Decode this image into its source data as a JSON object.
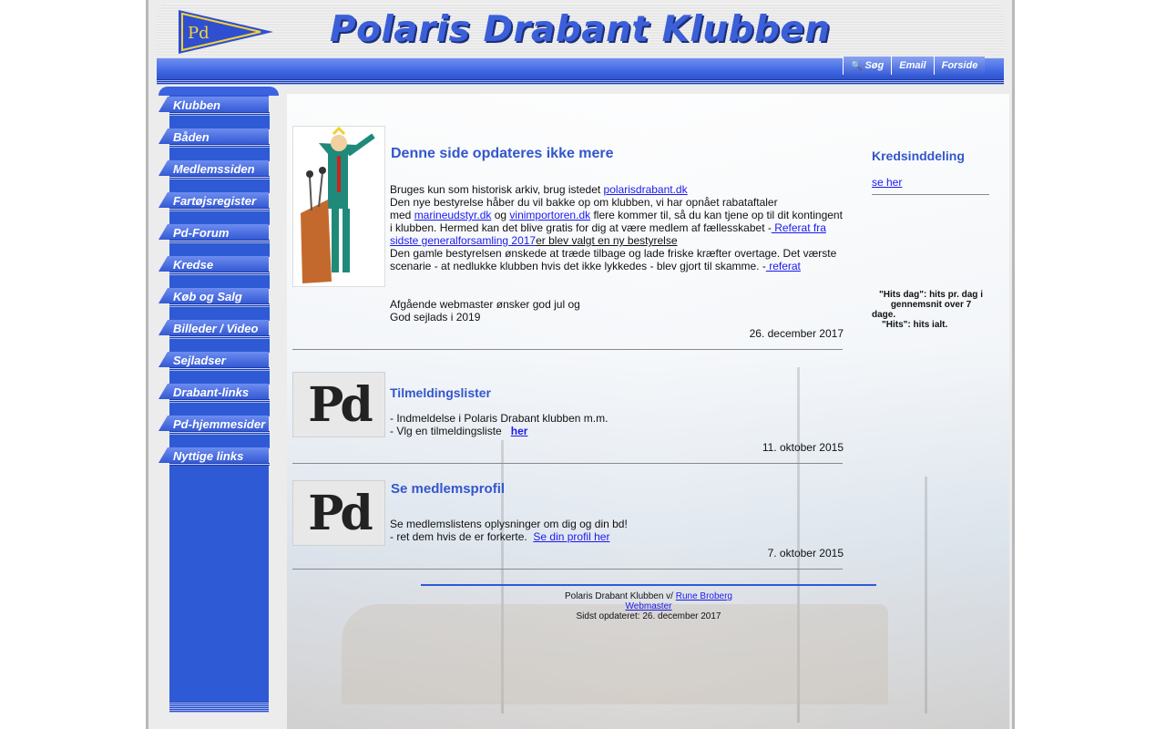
{
  "header": {
    "logo_text": "Pd",
    "site_title": "Polaris Drabant Klubben",
    "buttons": [
      {
        "label": "Søg",
        "icon": "search-icon"
      },
      {
        "label": "Email",
        "icon": ""
      },
      {
        "label": "Forside",
        "icon": ""
      }
    ]
  },
  "sidebar": {
    "items": [
      {
        "label": "Klubben"
      },
      {
        "label": "Båden"
      },
      {
        "label": "Medlemssiden"
      },
      {
        "label": "Fartøjsregister"
      },
      {
        "label": "Pd-Forum"
      },
      {
        "label": "Kredse"
      },
      {
        "label": "Køb og Salg"
      },
      {
        "label": "Billeder / Video"
      },
      {
        "label": "Sejladser"
      },
      {
        "label": "Drabant-links"
      },
      {
        "label": "Pd-hjemmesider"
      },
      {
        "label": "Nyttige links"
      }
    ]
  },
  "news": [
    {
      "title": "Denne side opdateres ikke mere",
      "p1_pre": "Bruges kun som historisk arkiv, brug istedet ",
      "p1_link": "polarisdrabant.dk",
      "p2_a": "Den nye bestyrelse håber du vil bakke op om klubben, vi har opnået rabataftaler",
      "p2_b": "med ",
      "p2_link1": "marineudstyr.dk",
      "p2_og": " og ",
      "p2_link2": "vinimportoren.dk",
      "p2_c": " flere kommer til, så du kan tjene op til dit kontingent",
      "p2_d": "i klubben. Hermed kan det blive gratis for dig at være medlem af fællesskabet -",
      "p2_link3a": " Referat fra",
      "p2_link3b": "sidste generalforsamling 2017",
      "p2_link4": "er blev valgt en ny bestyrelse",
      "p3_a": "Den gamle bestyrelsen ønskede at træde tilbage og lade friske kræfter overtage. Det værste",
      "p3_b": "scenarie - at nedlukke klubben hvis det ikke lykkedes - blev gjort til skamme. -",
      "p3_link": " referat",
      "greet_1": "Afgående webmaster ønsker god jul og",
      "greet_2": "God sejlads i 2019",
      "date": "26. december 2017"
    },
    {
      "title": "Tilmeldingslister",
      "line1": "- Indmeldelse i Polaris Drabant klubben m.m.",
      "line2": "- Vlg en tilmeldingsliste   ",
      "link": "her",
      "date": "11. oktober 2015"
    },
    {
      "title": "Se medlemsprofil",
      "line1": "Se medlemslistens oplysninger om dig og din bd!",
      "line2": "- ret dem hvis de er forkerte.  ",
      "link": "Se din profil her",
      "date": "7. oktober 2015"
    }
  ],
  "right": {
    "title": "Kredsinddeling",
    "link": "se her",
    "hits_1": "\"Hits dag\": hits pr. dag i",
    "hits_2": "gennemsnit over 7",
    "hits_3": "dage.",
    "hits_4": "\"Hits\": hits ialt."
  },
  "footer": {
    "line1_pre": "Polaris Drabant Klubben v/ ",
    "line1_link": "Rune Broberg",
    "line2_link": "Webmaster",
    "line3": "Sidst opdateret: 26. december 2017"
  },
  "colors": {
    "accent": "#3b63e0",
    "heading": "#3356cc",
    "link": "#1a1aee"
  }
}
